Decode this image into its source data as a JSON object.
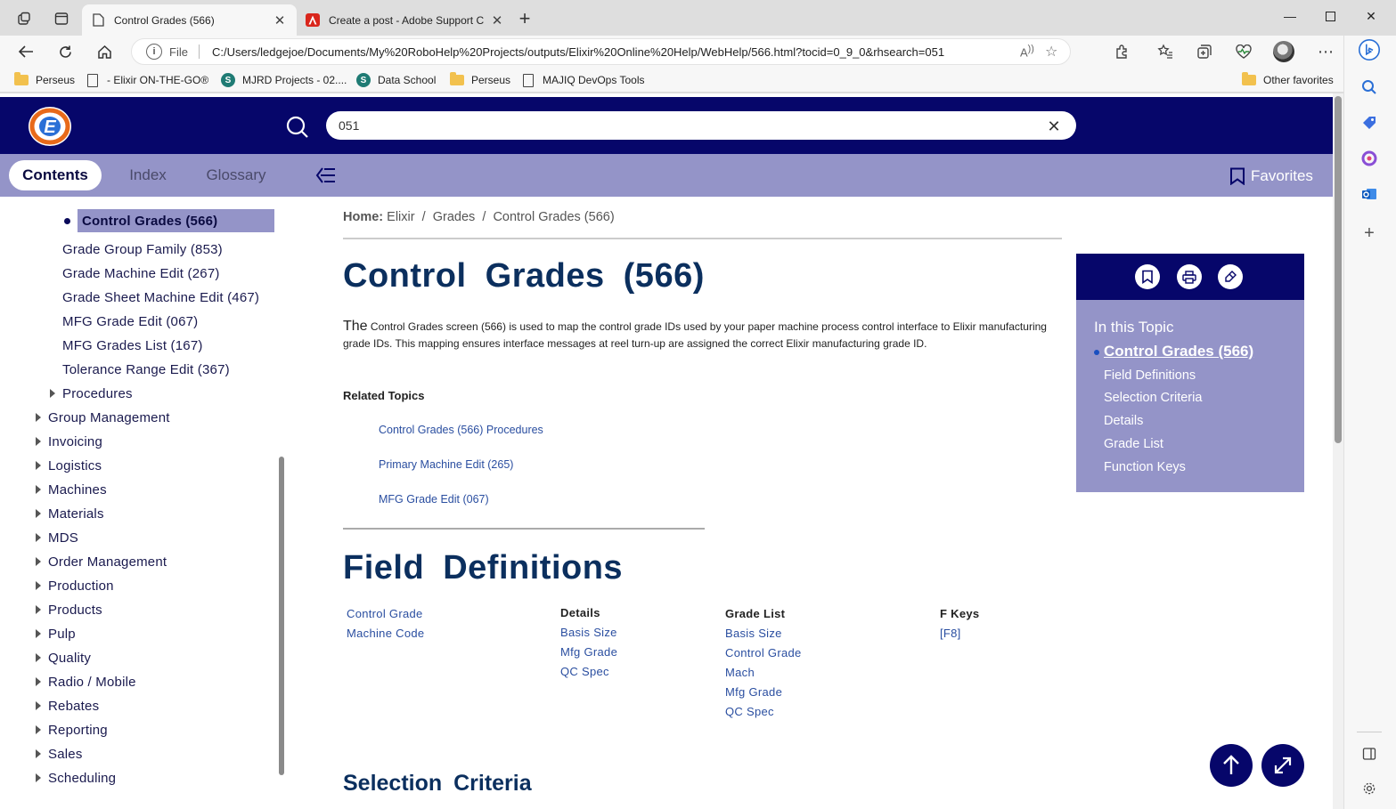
{
  "browser": {
    "tabs": [
      {
        "title": "Control Grades (566)",
        "active": true
      },
      {
        "title": "Create a post - Adobe Support C",
        "active": false
      }
    ],
    "address": {
      "scheme_label": "File",
      "url": "C:/Users/ledgejoe/Documents/My%20RoboHelp%20Projects/outputs/Elixir%20Online%20Help/WebHelp/566.html?tocid=0_9_0&rhsearch=051"
    },
    "favorites": [
      {
        "label": "Perseus",
        "icon": "folder-icon"
      },
      {
        "label": "- Elixir ON-THE-GO®",
        "icon": "page-icon"
      },
      {
        "label": "MJRD Projects - 02....",
        "icon": "sharepoint-icon"
      },
      {
        "label": "Data School",
        "icon": "sharepoint-icon"
      },
      {
        "label": "Perseus",
        "icon": "folder-icon"
      },
      {
        "label": "MAJIQ DevOps Tools",
        "icon": "page-icon"
      }
    ],
    "other_favorites": "Other favorites",
    "accent_color": "#06066a"
  },
  "help": {
    "search_value": "051",
    "tabs": [
      "Contents",
      "Index",
      "Glossary"
    ],
    "favorites_label": "Favorites",
    "toc": {
      "selected": "Control Grades (566)",
      "children": [
        "Grade Group Family (853)",
        "Grade Machine Edit (267)",
        "Grade Sheet Machine Edit (467)",
        "MFG Grade Edit (067)",
        "MFG Grades List (167)",
        "Tolerance Range Edit (367)"
      ],
      "procedures": "Procedures",
      "top_level": [
        "Group Management",
        "Invoicing",
        "Logistics",
        "Machines",
        "Materials",
        "MDS",
        "Order Management",
        "Production",
        "Products",
        "Pulp",
        "Quality",
        "Radio / Mobile",
        "Rebates",
        "Reporting",
        "Sales",
        "Scheduling"
      ]
    },
    "breadcrumb": {
      "home_label": "Home:",
      "items": [
        "Elixir",
        "Grades",
        "Control Grades (566)"
      ],
      "separator": "/"
    },
    "title": "Control Grades (566)",
    "intro_first_word": "The",
    "intro_rest": " Control Grades screen (566) is used to map the control grade IDs used by your paper machine process control interface to Elixir manufacturing grade IDs.  This mapping ensures interface messages at reel turn-up are assigned the correct Elixir manufacturing grade ID.",
    "related_heading": "Related Topics",
    "related": [
      "Control Grades (566) Procedures",
      "Primary Machine Edit (265)",
      "MFG Grade Edit (067)"
    ],
    "field_definitions_title": "Field Definitions",
    "field_columns": [
      {
        "heading": "",
        "links": [
          "Control Grade",
          "Machine Code"
        ]
      },
      {
        "heading": "Details",
        "links": [
          "Basis Size",
          "Mfg Grade",
          "QC Spec"
        ]
      },
      {
        "heading": "Grade List",
        "links": [
          "Basis Size",
          "Control Grade",
          "Mach",
          "Mfg Grade",
          "QC Spec"
        ]
      },
      {
        "heading": "F Keys",
        "links": [
          "[F8]"
        ]
      }
    ],
    "selection_criteria_title": "Selection Criteria",
    "in_this_topic": {
      "title": "In this Topic",
      "current": "Control Grades (566)",
      "links": [
        "Field Definitions",
        "Selection Criteria",
        "Details",
        "Grade List",
        "Function Keys"
      ]
    }
  }
}
